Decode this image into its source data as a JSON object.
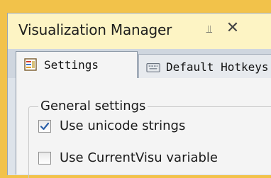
{
  "window": {
    "title": "Visualization Manager",
    "pin_icon": "pin-icon",
    "close_icon": "close-icon"
  },
  "tabs": [
    {
      "label": "Settings",
      "icon": "settings-icon",
      "active": true
    },
    {
      "label": "Default Hotkeys",
      "icon": "keyboard-icon",
      "active": false
    }
  ],
  "general_settings": {
    "title": "General settings",
    "options": [
      {
        "label": "Use unicode strings",
        "checked": true
      },
      {
        "label": "Use CurrentVisu variable",
        "checked": false
      }
    ]
  },
  "colors": {
    "title_bar": "#fdf4c4",
    "accent": "#f2c24a",
    "check_mark": "#2b5fa8"
  }
}
